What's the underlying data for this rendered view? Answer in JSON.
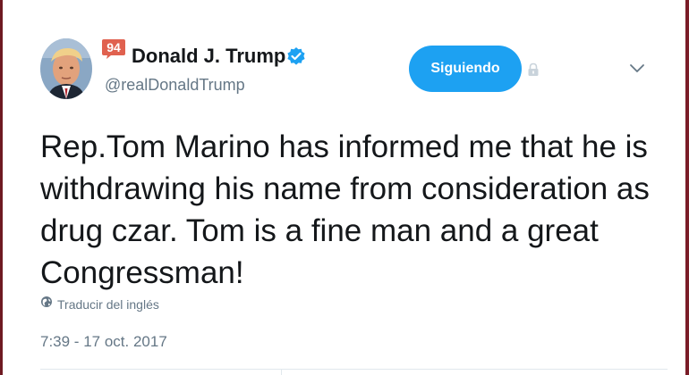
{
  "user": {
    "display_name": "Donald J. Trump",
    "handle": "@realDonaldTrump",
    "badge_count": "94",
    "badge_color": "#e0614f",
    "verified_color": "#1da1f2"
  },
  "actions": {
    "follow_label": "Siguiendo",
    "follow_color": "#1da1f2",
    "more_icon": "chevron-down-icon"
  },
  "tweet": {
    "text": "Rep.Tom Marino has informed me that he is withdrawing his name from consideration as drug czar. Tom is a fine man and a great Congressman!",
    "translate_label": "Traducir del inglés",
    "timestamp": "7:39 - 17 oct. 2017"
  },
  "icons": [
    "avatar",
    "badge-icon",
    "verified-icon",
    "lock-icon",
    "globe-icon",
    "chevron-down-icon"
  ]
}
